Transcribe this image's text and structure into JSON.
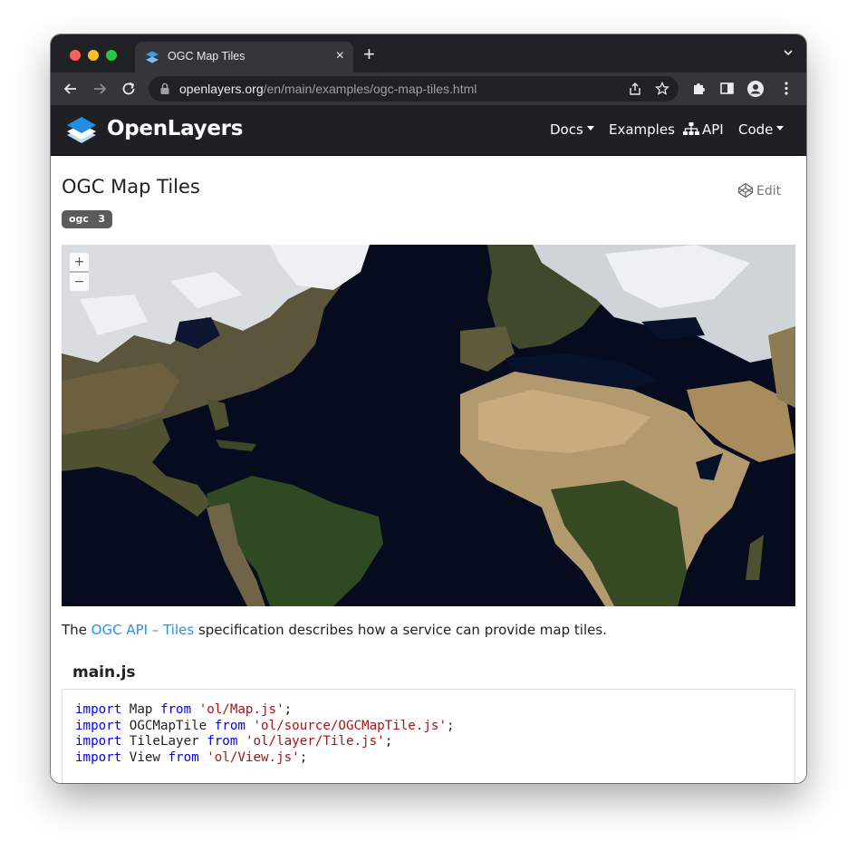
{
  "browser": {
    "tab_title": "OGC Map Tiles",
    "url_domain": "openlayers.org",
    "url_path": "/en/main/examples/ogc-map-tiles.html"
  },
  "navbar": {
    "brand": "OpenLayers",
    "links": {
      "docs": "Docs",
      "examples": "Examples",
      "api": "API",
      "code": "Code"
    }
  },
  "page": {
    "title": "OGC Map Tiles",
    "edit_label": "Edit",
    "tag": {
      "name": "ogc",
      "count": "3"
    },
    "map": {
      "zoom_in": "+",
      "zoom_out": "−"
    },
    "description": {
      "before": "The ",
      "link": "OGC API – Tiles",
      "after": " specification describes how a service can provide map tiles."
    },
    "file_title": "main.js",
    "code_lines": [
      {
        "kw1": "import",
        "name": " Map ",
        "kw2": "from",
        "str": "'ol/Map.js'",
        "end": ";"
      },
      {
        "kw1": "import",
        "name": " OGCMapTile ",
        "kw2": "from",
        "str": "'ol/source/OGCMapTile.js'",
        "end": ";"
      },
      {
        "kw1": "import",
        "name": " TileLayer ",
        "kw2": "from",
        "str": "'ol/layer/Tile.js'",
        "end": ";"
      },
      {
        "kw1": "import",
        "name": " View ",
        "kw2": "from",
        "str": "'ol/View.js'",
        "end": ";"
      }
    ]
  },
  "colors": {
    "brand_blue": "#2d91e6",
    "navbar_bg": "#1f2023",
    "keyword": "#0000ff",
    "string": "#a31515"
  }
}
